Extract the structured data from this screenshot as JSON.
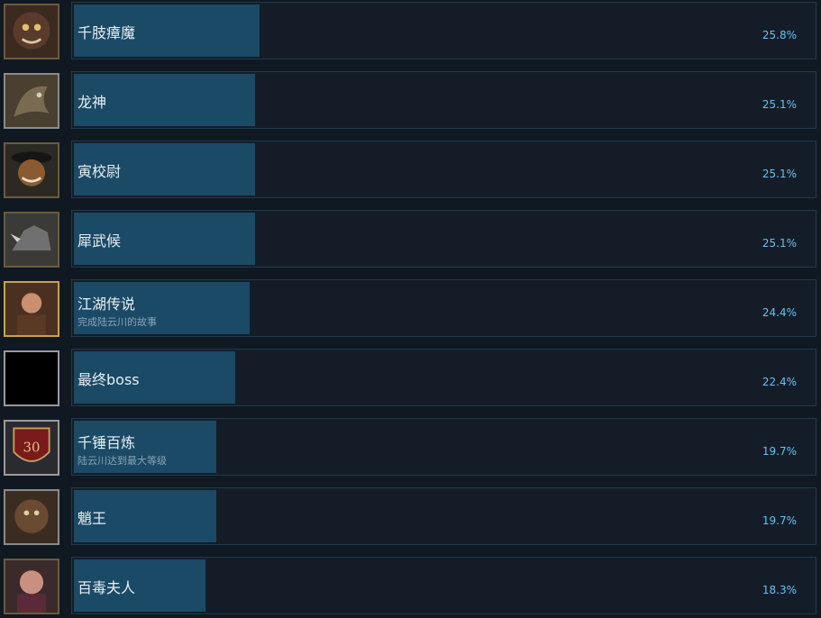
{
  "achievements": [
    {
      "title": "千肢瘴魔",
      "desc": "",
      "percent_label": "25.8%",
      "percent": 25.8,
      "icon": "demon-face-icon",
      "frame": "#6b5b3c",
      "bg": "#3a2a20"
    },
    {
      "title": "龙神",
      "desc": "",
      "percent_label": "25.1%",
      "percent": 25.1,
      "icon": "dragon-god-icon",
      "frame": "#8a8a8a",
      "bg": "#4a4030"
    },
    {
      "title": "寅校尉",
      "desc": "",
      "percent_label": "25.1%",
      "percent": 25.1,
      "icon": "tiger-captain-icon",
      "frame": "#6b5b3c",
      "bg": "#2a2a22"
    },
    {
      "title": "犀武候",
      "desc": "",
      "percent_label": "25.1%",
      "percent": 25.1,
      "icon": "rhino-general-icon",
      "frame": "#6b5b3c",
      "bg": "#3a3a36"
    },
    {
      "title": "江湖传说",
      "desc": "完成陆云川的故事",
      "percent_label": "24.4%",
      "percent": 24.4,
      "icon": "hero-portrait-icon",
      "frame": "#c9a24a",
      "bg": "#4a3020"
    },
    {
      "title": "最终boss",
      "desc": "",
      "percent_label": "22.4%",
      "percent": 22.4,
      "icon": "hidden-achievement-icon",
      "frame": "#9a9a9a",
      "bg": "#000000"
    },
    {
      "title": "千锤百炼",
      "desc": "陆云川达到最大等级",
      "percent_label": "19.7%",
      "percent": 19.7,
      "icon": "level-30-shield-icon",
      "frame": "#9a9a9a",
      "bg": "#2a2a30"
    },
    {
      "title": "魈王",
      "desc": "",
      "percent_label": "19.7%",
      "percent": 19.7,
      "icon": "mandrill-king-icon",
      "frame": "#8a8a8a",
      "bg": "#3a2c20"
    },
    {
      "title": "百毒夫人",
      "desc": "",
      "percent_label": "18.3%",
      "percent": 18.3,
      "icon": "poison-lady-icon",
      "frame": "#6b5b3c",
      "bg": "#3a2a2a"
    }
  ]
}
